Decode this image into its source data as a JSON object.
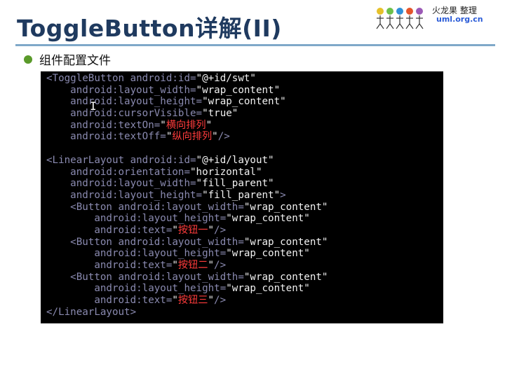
{
  "slide": {
    "title": "ToggleButton详解(II)",
    "bullet": "组件配置文件"
  },
  "logo": {
    "line1": "火龙果 整理",
    "line2": "uml.org.cn"
  },
  "colors": {
    "title": "#1f3a5f",
    "rule": "#7fa8c9",
    "bullet": "#5a9a2a",
    "code_bg": "#000000",
    "code_keyword": "#8a8ab0",
    "code_value": "#f2f2f2",
    "code_chinese": "#ff3b3b"
  },
  "code": {
    "lines": [
      "<ToggleButton android:id=\"@+id/swt\"",
      "    android:layout_width=\"wrap_content\"",
      "    android:layout_height=\"wrap_content\"",
      "    android:cursorVisible=\"true\"",
      "    android:textOn=\"横向排列\"",
      "    android:textOff=\"纵向排列\"/>",
      "",
      "<LinearLayout android:id=\"@+id/layout\"",
      "    android:orientation=\"horizontal\"",
      "    android:layout_width=\"fill_parent\"",
      "    android:layout_height=\"fill_parent\">",
      "    <Button android:layout_width=\"wrap_content\"",
      "        android:layout_height=\"wrap_content\"",
      "        android:text=\"按钮一\"/>",
      "    <Button android:layout_width=\"wrap_content\"",
      "        android:layout_height=\"wrap_content\"",
      "        android:text=\"按钮二\"/>",
      "    <Button android:layout_width=\"wrap_content\"",
      "        android:layout_height=\"wrap_content\"",
      "        android:text=\"按钮三\"/>",
      "</LinearLayout>"
    ]
  }
}
